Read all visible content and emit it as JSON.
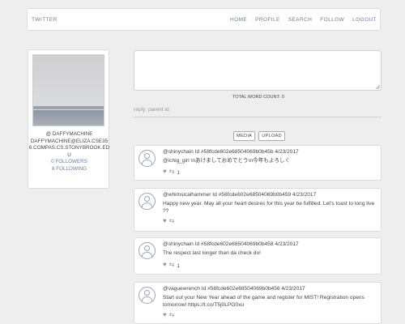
{
  "navbar": {
    "brand": "TWITTER",
    "links": [
      "HOME",
      "PROFILE",
      "SEARCH",
      "FOLLOW",
      "LOGOUT"
    ]
  },
  "profile": {
    "handle": "@ DAFFYMACHINE",
    "email_lines": [
      "DAFFYMACHINE@ELIZA.CSE35",
      "6.COMPAS.CS.STONYBROOK.ED",
      "U"
    ],
    "followers_count": "0",
    "followers_label": "FOLLOWERS",
    "following_count": "8",
    "following_label": "FOLLOWING"
  },
  "composer": {
    "text": "",
    "word_count_label": "TOTAL WORD COUNT:",
    "word_count": "0",
    "reply_placeholder": "reply: parent id",
    "media_label": "MEDIA",
    "upload_label": "UPLOAD"
  },
  "tweets": [
    {
      "header": "@shinychain Id #58fcde602e68504069b0b45b 4/23/2017",
      "body": "@ichig_girl \\nあけましておめでとう\\n今年もよろしく",
      "retweets": "1"
    },
    {
      "header": "@whimsicalhammer Id #58fcde602e68504069b0b459 4/23/2017",
      "body": "Happy new year. May all your heart desires for this year be fulfilled. Let's toast to long live ??",
      "retweets": ""
    },
    {
      "header": "@shinychain Id #58fcde602e68504069b0b458 4/23/2017",
      "body": "The respect last longer than da check do!",
      "retweets": "1"
    },
    {
      "header": "@vaguewrench Id #58fcde602e68504069b0b456 4/23/2017",
      "body": "Start out your New Year ahead of the game and register for MIST! Registration opens tomorrow! https://t.co/T5j0LPG0xu",
      "retweets": ""
    }
  ]
}
